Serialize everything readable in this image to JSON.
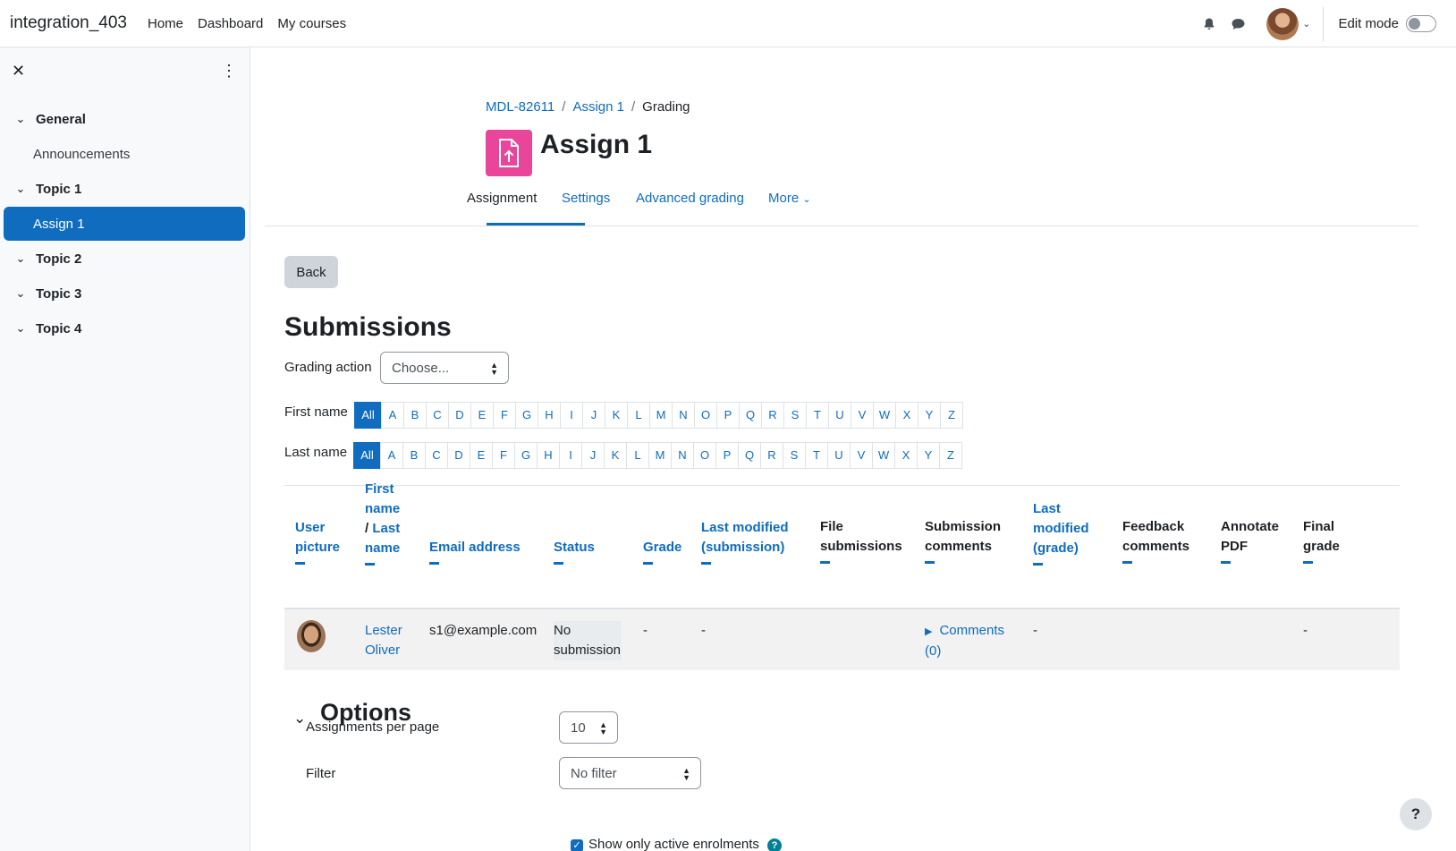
{
  "navbar": {
    "brand": "integration_403",
    "links": [
      "Home",
      "Dashboard",
      "My courses"
    ],
    "edit_mode": "Edit mode"
  },
  "drawer": {
    "items": [
      {
        "label": "General",
        "type": "section"
      },
      {
        "label": "Announcements",
        "type": "activity"
      },
      {
        "label": "Topic 1",
        "type": "section"
      },
      {
        "label": "Assign 1",
        "type": "activity",
        "active": true
      },
      {
        "label": "Topic 2",
        "type": "section"
      },
      {
        "label": "Topic 3",
        "type": "section"
      },
      {
        "label": "Topic 4",
        "type": "section"
      }
    ]
  },
  "breadcrumb": [
    "MDL-82611",
    "Assign 1",
    "Grading"
  ],
  "page_title": "Assign 1",
  "tabs": [
    "Assignment",
    "Settings",
    "Advanced grading",
    "More"
  ],
  "back_label": "Back",
  "submissions_heading": "Submissions",
  "grading_action": {
    "label": "Grading action",
    "value": "Choose..."
  },
  "initials": {
    "first_label": "First name",
    "last_label": "Last name",
    "all": "All",
    "letters": [
      "A",
      "B",
      "C",
      "D",
      "E",
      "F",
      "G",
      "H",
      "I",
      "J",
      "K",
      "L",
      "M",
      "N",
      "O",
      "P",
      "Q",
      "R",
      "S",
      "T",
      "U",
      "V",
      "W",
      "X",
      "Y",
      "Z"
    ]
  },
  "table": {
    "headers": {
      "user_picture": [
        "User",
        "picture"
      ],
      "name_first": [
        "First",
        "name"
      ],
      "name_sep": "/ ",
      "name_last": [
        "Last",
        "name"
      ],
      "email": "Email address",
      "status": "Status",
      "grade": "Grade",
      "last_modified_sub": [
        "Last modified",
        "(submission)"
      ],
      "file_submissions": [
        "File",
        "submissions"
      ],
      "submission_comments": [
        "Submission",
        "comments"
      ],
      "last_modified_grade": [
        "Last",
        "modified",
        "(grade)"
      ],
      "feedback_comments": [
        "Feedback",
        "comments"
      ],
      "annotate_pdf": [
        "Annotate",
        "PDF"
      ],
      "final_grade": [
        "Final",
        "grade"
      ]
    },
    "row": {
      "name": [
        "Lester",
        "Oliver"
      ],
      "email": "s1@example.com",
      "status": [
        "No",
        "submission"
      ],
      "grade": "-",
      "last_modified": "-",
      "comments": [
        "Comments",
        "(0)"
      ],
      "last_modified_grade": "-",
      "final_grade": "-"
    }
  },
  "options": {
    "title": "Options",
    "per_page_label": "Assignments per page",
    "per_page_value": "10",
    "filter_label": "Filter",
    "filter_value": "No filter",
    "active_enrolments": "Show only active enrolments"
  },
  "help_fab": "?"
}
